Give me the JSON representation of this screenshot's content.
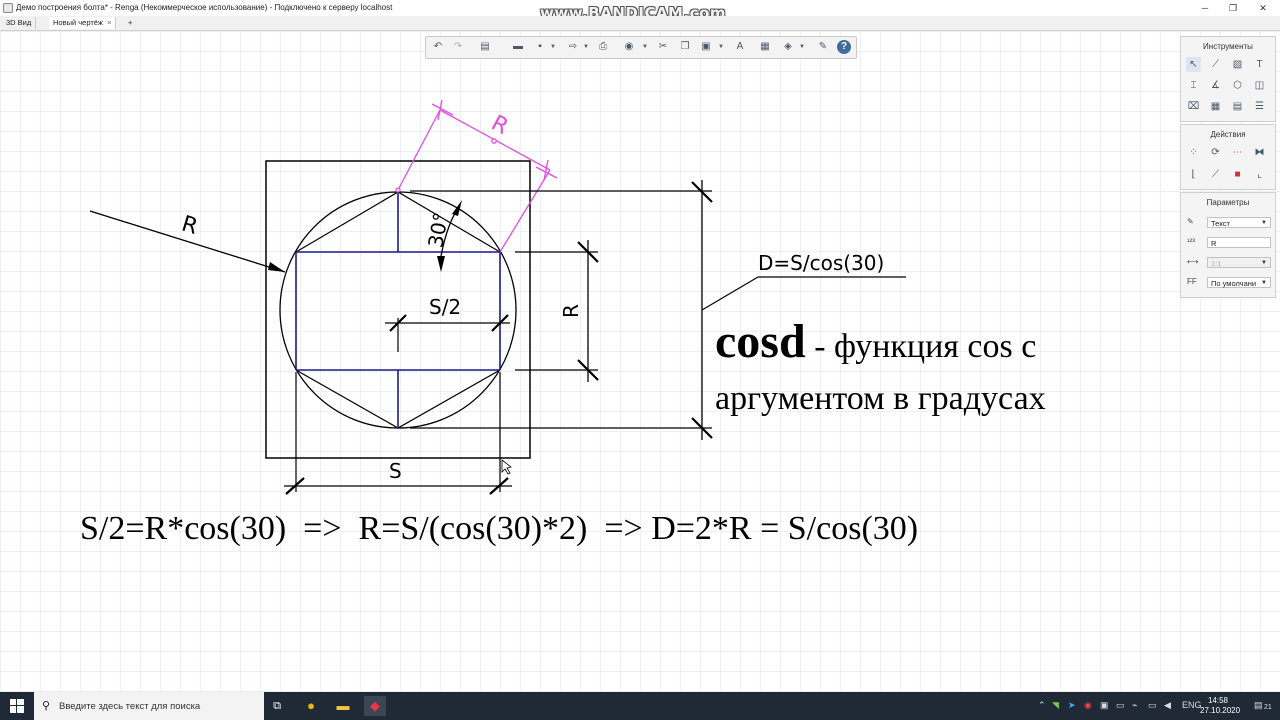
{
  "window": {
    "title": "Демо построения болта* - Renga (Некоммерческое использование) - Подключено к серверу localhost",
    "watermark": "www.BANDICAM.com"
  },
  "tabs": [
    {
      "label": "3D Вид",
      "close": "×"
    },
    {
      "label": "Новый чертёж",
      "close": "×"
    }
  ],
  "new_tab_label": "+",
  "panels": {
    "tools_title": "Инструменты",
    "actions_title": "Действия",
    "params_title": "Параметры",
    "params": {
      "style_value": "Текст",
      "text_value": "R",
      "scale_value": "1:1",
      "font_value": "По умолчани"
    }
  },
  "drawing": {
    "dim_R_left": "R",
    "dim_R_top": "R",
    "angle_label": "30°",
    "half_s_label": "S/2",
    "dim_R_vertical": "R",
    "dim_S": "S",
    "d_note": "D=S/cos(30)"
  },
  "caption": {
    "keyword": "cosd",
    "line1_rest": " - функция cos с",
    "line2": "аргументом в градусах"
  },
  "formula": "S/2=R*cos(30)  =>  R=S/(cos(30)*2)  => D=2*R = S/cos(30)",
  "taskbar": {
    "search_placeholder": "Введите здесь текст для поиска",
    "lang": "ENG",
    "time": "14:58",
    "date": "27.10.2020",
    "notification_count": "21"
  }
}
